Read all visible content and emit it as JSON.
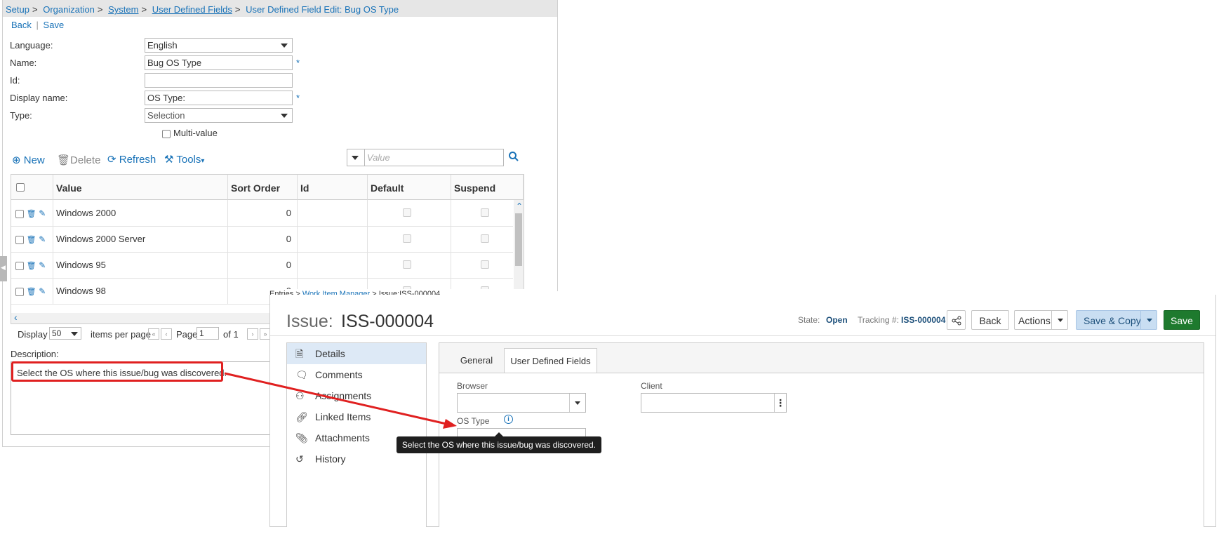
{
  "admin": {
    "breadcrumb": {
      "setup": "Setup",
      "sep1": ">",
      "organization": "Organization",
      "sep2": ">",
      "system": "System",
      "sep3": ">",
      "user_defined_fields": "User Defined Fields",
      "sep4": ">",
      "current": "User Defined Field Edit: Bug OS Type"
    },
    "actions": {
      "back": "Back",
      "divider": "|",
      "save": "Save"
    },
    "form": {
      "language_label": "Language:",
      "language_value": "English",
      "name_label": "Name:",
      "name_value": "Bug OS Type",
      "required_mark": "*",
      "id_label": "Id:",
      "id_value": "",
      "display_name_label": "Display name:",
      "display_name_value": "OS Type:",
      "type_label": "Type:",
      "type_value": "Selection",
      "multivalue_label": "Multi-value"
    },
    "toolbar": {
      "new": "New",
      "delete": "Delete",
      "refresh": "Refresh",
      "tools": "Tools",
      "filter_placeholder": "Value"
    },
    "grid": {
      "columns": [
        "Value",
        "Sort Order",
        "Id",
        "Default",
        "Suspend"
      ],
      "rows": [
        {
          "value": "Windows 2000",
          "sort_order": "0",
          "id": ""
        },
        {
          "value": "Windows 2000 Server",
          "sort_order": "0",
          "id": ""
        },
        {
          "value": "Windows 95",
          "sort_order": "0",
          "id": ""
        },
        {
          "value": "Windows 98",
          "sort_order": "0",
          "id": ""
        }
      ]
    },
    "pager": {
      "display_label": "Display",
      "page_size": "50",
      "items_per_page": "items per page",
      "page_label": "Page",
      "page_value": "1",
      "of_label": "of 1"
    },
    "description": {
      "label": "Description:",
      "text": "Select the OS where this issue/bug was discovered."
    }
  },
  "issue": {
    "breadcrumb": {
      "entries": "Entries",
      "sep1": ">",
      "work_item_manager": "Work Item Manager",
      "sep2": ">",
      "current": "Issue:ISS-000004"
    },
    "title_prefix": "Issue:",
    "title_id": "ISS-000004",
    "state_label": "State:",
    "state_value": "Open",
    "tracking_label": "Tracking #:",
    "tracking_value": "ISS-000004",
    "buttons": {
      "back": "Back",
      "actions": "Actions",
      "save_copy": "Save & Copy",
      "save": "Save"
    },
    "sidenav": [
      "Details",
      "Comments",
      "Assignments",
      "Linked Items",
      "Attachments",
      "History"
    ],
    "tabs": [
      "General",
      "User Defined Fields"
    ],
    "fields": {
      "browser_label": "Browser",
      "client_label": "Client",
      "os_type_label": "OS Type"
    },
    "tooltip": "Select the OS where this issue/bug was discovered."
  },
  "colors": {
    "link": "#1a73b8",
    "highlight_red": "#e02020",
    "save_green": "#1e7a2e",
    "save_copy_blue": "#c9def2"
  }
}
